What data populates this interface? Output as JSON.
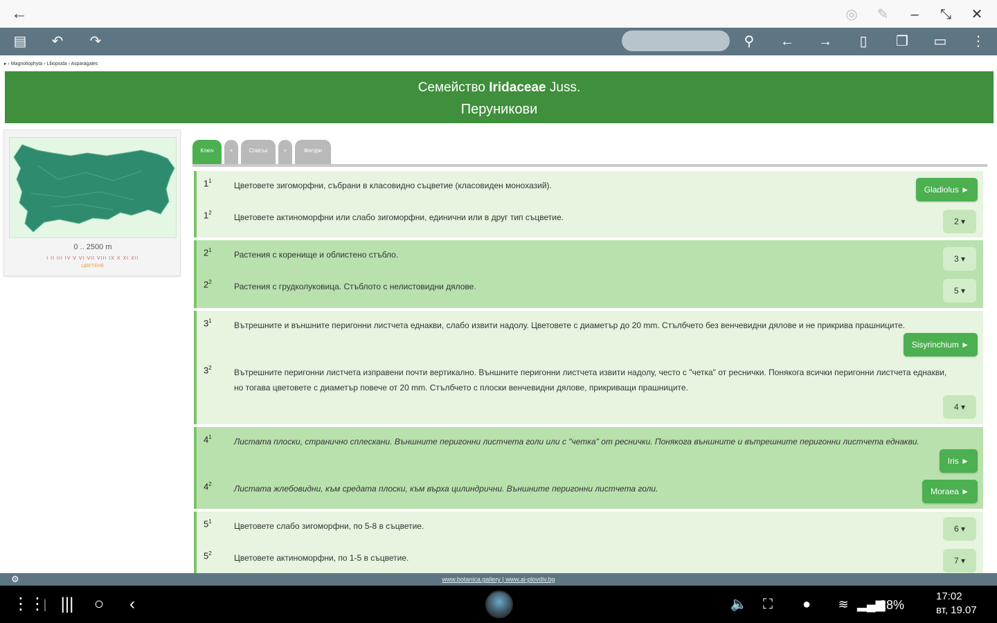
{
  "toolbar": {
    "search_placeholder": "",
    "icons": [
      "menu-icon",
      "undo-icon",
      "redo-icon",
      "search-icon",
      "arrow-left-icon",
      "arrow-right-icon",
      "bookmark-icon",
      "copy-icon",
      "card-icon",
      "more-vert-icon"
    ]
  },
  "breadcrumb": "▸ › Magnoliophyta › Liliopsida › Asparagales",
  "header": {
    "family_prefix": "Семейство",
    "family_name": "Iridaceae",
    "family_author": "Juss.",
    "common_name": "Перуникови"
  },
  "sidebar": {
    "altitude": "0 .. 2500 m",
    "months": "I II III IV V VI VII VIII IX X XI XII",
    "flowering": "ЦВЕТЕНЕ"
  },
  "tabs": [
    {
      "label": "Ключ",
      "active": true
    },
    {
      "label": "+",
      "active": false
    },
    {
      "label": "Списък",
      "active": false
    },
    {
      "label": "+",
      "active": false
    },
    {
      "label": "Фигури",
      "active": false
    }
  ],
  "key": [
    {
      "leads": [
        {
          "num": "1",
          "sup": "1",
          "text": "Цветовете зигоморфни, събрани в класовидно съцветие (класовиден монохазий).",
          "button": "Gladiolus ►",
          "button_type": "go"
        },
        {
          "num": "1",
          "sup": "2",
          "text": "Цветовете актиноморфни или слабо зигоморфни, единични или в друг тип съцветие.",
          "button": "2 ▾",
          "button_type": "step"
        }
      ]
    },
    {
      "leads": [
        {
          "num": "2",
          "sup": "1",
          "text": "Растения с коренище и облистено стъбло.",
          "button": "3 ▾",
          "button_type": "step"
        },
        {
          "num": "2",
          "sup": "2",
          "text": "Растения с грудколуковица. Стъблото с нелистовидни дялове.",
          "button": "5 ▾",
          "button_type": "step"
        }
      ]
    },
    {
      "leads": [
        {
          "num": "3",
          "sup": "1",
          "text": "Вътрешните и външните перигонни листчета еднакви, слабо извити надолу. Цветовете с диаметър до 20 mm. Стълбчето без венчевидни дялове и не прикрива прашниците.",
          "button": "Sisyrinchium ►",
          "button_type": "go"
        },
        {
          "num": "3",
          "sup": "2",
          "text": "Вътрешните перигонни листчета изправени почти вертикално. Външните перигонни листчета извити надолу, често с \"четка\" от реснички. Понякога всички перигонни листчета еднакви, но тогава цветовете с диаметър повече от 20 mm. Стълбчето с плоски венчевидни дялове, прикриващи прашниците.",
          "button": "4 ▾",
          "button_type": "step"
        }
      ]
    },
    {
      "leads": [
        {
          "num": "4",
          "sup": "1",
          "text": "Листата плоски, странично сплескани. Външните перигонни листчета голи или с \"четка\" от реснички. Понякога външните и вътрешните перигонни листчета еднакви.",
          "button": "Iris ►",
          "button_type": "go"
        },
        {
          "num": "4",
          "sup": "2",
          "text": "Листата жлебовидни, към средата плоски, към върха цилиндрични. Външните перигонни листчета голи.",
          "button": "Moraea ►",
          "button_type": "go"
        }
      ]
    },
    {
      "leads": [
        {
          "num": "5",
          "sup": "1",
          "text": "Цветовете слабо зигоморфни, по 5-8 в съцветие.",
          "button": "6 ▾",
          "button_type": "step"
        },
        {
          "num": "5",
          "sup": "2",
          "text": "Цветовете актиноморфни, по 1-5 в съцветие.",
          "button": "7 ▾",
          "button_type": "step"
        }
      ]
    }
  ],
  "footer": {
    "links": "www.botanica.gallery | www.ai-plovdiv.bg"
  },
  "statusbar": {
    "battery": "28%",
    "time": "17:02",
    "date": "вт, 19.07"
  },
  "colors": {
    "header_green": "#3f8f3c",
    "button_green": "#4caf50",
    "toolbar": "#5e7583",
    "map_fill": "#2e8b6e"
  }
}
